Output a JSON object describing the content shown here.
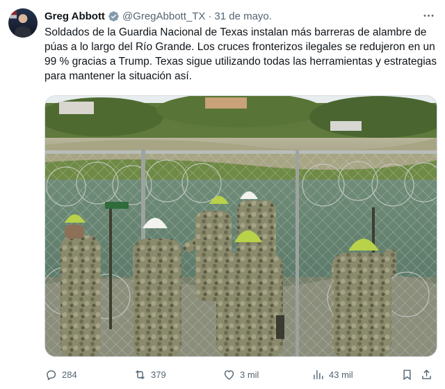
{
  "author": {
    "name": "Greg Abbott",
    "handle": "@GregAbbott_TX",
    "separator": "·",
    "date": "31 de mayo."
  },
  "tweet": {
    "text": "Soldados de la Guardia Nacional de Texas instalan más barreras de alambre de púas a lo largo del Río Grande. Los cruces fronterizos ilegales se redujeron en un 99 % gracias a Trump. Texas sigue utilizando todas las herramientas y estrategias para mantener la situación así."
  },
  "metrics": {
    "replies": "284",
    "reposts": "379",
    "likes": "3 mil",
    "views": "43 mil"
  },
  "icons": {
    "verified": "verified-badge-icon",
    "more": "more-options-icon",
    "reply": "reply-icon",
    "repost": "repost-icon",
    "like": "like-icon",
    "views": "views-icon",
    "bookmark": "bookmark-icon",
    "share": "share-icon"
  },
  "colors": {
    "text": "#0f1419",
    "muted": "#536471",
    "verified": "#829aab",
    "border": "#cfd9de"
  }
}
